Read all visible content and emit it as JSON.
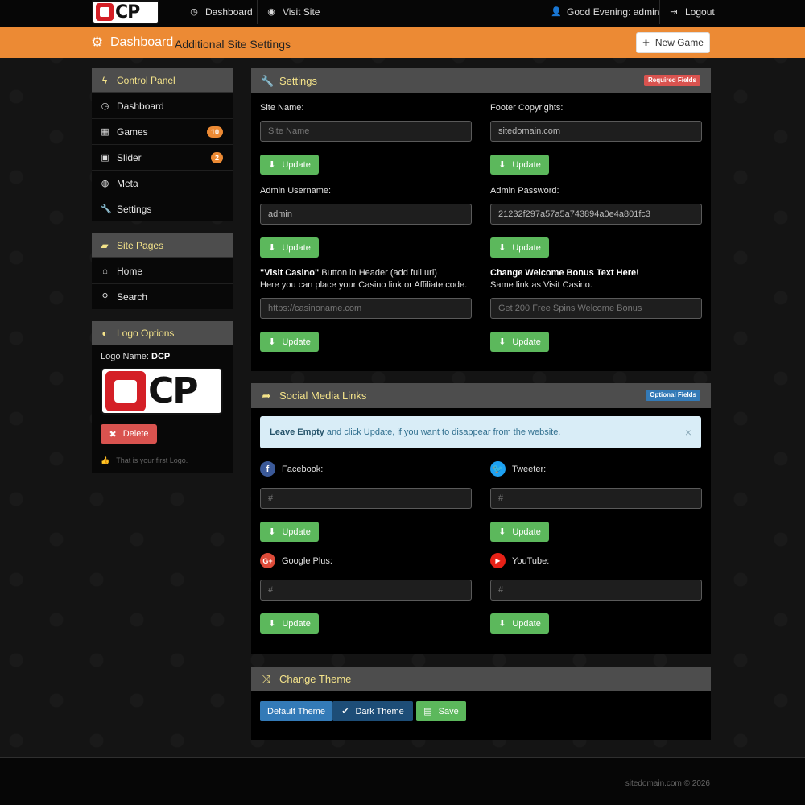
{
  "topnav": {
    "logo_text": "CP",
    "dashboard_label": "Dashboard",
    "visit_site_label": "Visit Site",
    "greeting": "Good Evening: admin",
    "logout_label": "Logout"
  },
  "header": {
    "title": "Dashboard",
    "subtitle": "Additional Site Settings",
    "new_game_label": "New Game"
  },
  "control_panel": {
    "title": "Control Panel",
    "items": [
      {
        "label": "Dashboard",
        "icon": "dashboard-icon"
      },
      {
        "label": "Games",
        "icon": "table-icon",
        "badge": "10"
      },
      {
        "label": "Slider",
        "icon": "picture-icon",
        "badge": "2"
      },
      {
        "label": "Meta",
        "icon": "globe-icon"
      },
      {
        "label": "Settings",
        "icon": "wrench-icon"
      }
    ]
  },
  "site_pages": {
    "title": "Site Pages",
    "items": [
      {
        "label": "Home",
        "icon": "home-icon"
      },
      {
        "label": "Search",
        "icon": "search-icon"
      }
    ]
  },
  "logo_options": {
    "title": "Logo Options",
    "name_label": "Logo Name:",
    "name_value": "DCP",
    "logo_text": "CP",
    "delete_label": "Delete",
    "hint": "That is your first Logo."
  },
  "settings": {
    "title": "Settings",
    "tag": "Required Fields",
    "update_label": "Update",
    "site_name": {
      "label": "Site Name:",
      "placeholder": "Site Name"
    },
    "footer_copyrights": {
      "label": "Footer Copyrights:",
      "value": "sitedomain.com"
    },
    "admin_username": {
      "label": "Admin Username:",
      "value": "admin"
    },
    "admin_password": {
      "label": "Admin Password:",
      "value": "21232f297a57a5a743894a0e4a801fc3"
    },
    "visit_casino": {
      "label_bold": "\"Visit Casino\"",
      "label_rest": " Button in Header (add full url)",
      "label_line2": "Here you can place your Casino link or Affiliate code.",
      "placeholder": "https://casinoname.com"
    },
    "welcome_bonus": {
      "label_bold": "Change Welcome Bonus Text Here!",
      "label_line2": "Same link as Visit Casino.",
      "placeholder": "Get 200 Free Spins Welcome Bonus"
    }
  },
  "social": {
    "title": "Social Media Links",
    "tag": "Optional Fields",
    "alert_bold": "Leave Empty",
    "alert_rest": " and click Update, if you want to disappear from the website.",
    "alert_close": "×",
    "update_label": "Update",
    "facebook": {
      "label": "Facebook:",
      "value": "#"
    },
    "tweeter": {
      "label": "Tweeter:",
      "value": "#"
    },
    "google_plus": {
      "label": "Google Plus:",
      "value": "#"
    },
    "youtube": {
      "label": "YouTube:",
      "value": "#"
    }
  },
  "theme": {
    "title": "Change Theme",
    "default_label": "Default Theme",
    "dark_label": "Dark Theme",
    "save_label": "Save"
  },
  "footer": {
    "copyright": "sitedomain.com © 2026"
  },
  "colors": {
    "accent_orange": "#ec8a34",
    "update_green": "#5cb85c",
    "delete_red": "#d9534f",
    "panel_heading_text": "#f4e38a",
    "required_tag": "#d9534f",
    "optional_tag": "#337ab7",
    "facebook": "#3b5998",
    "tweeter": "#1da1f2",
    "google_plus": "#dd4b39",
    "youtube": "#e62117"
  }
}
